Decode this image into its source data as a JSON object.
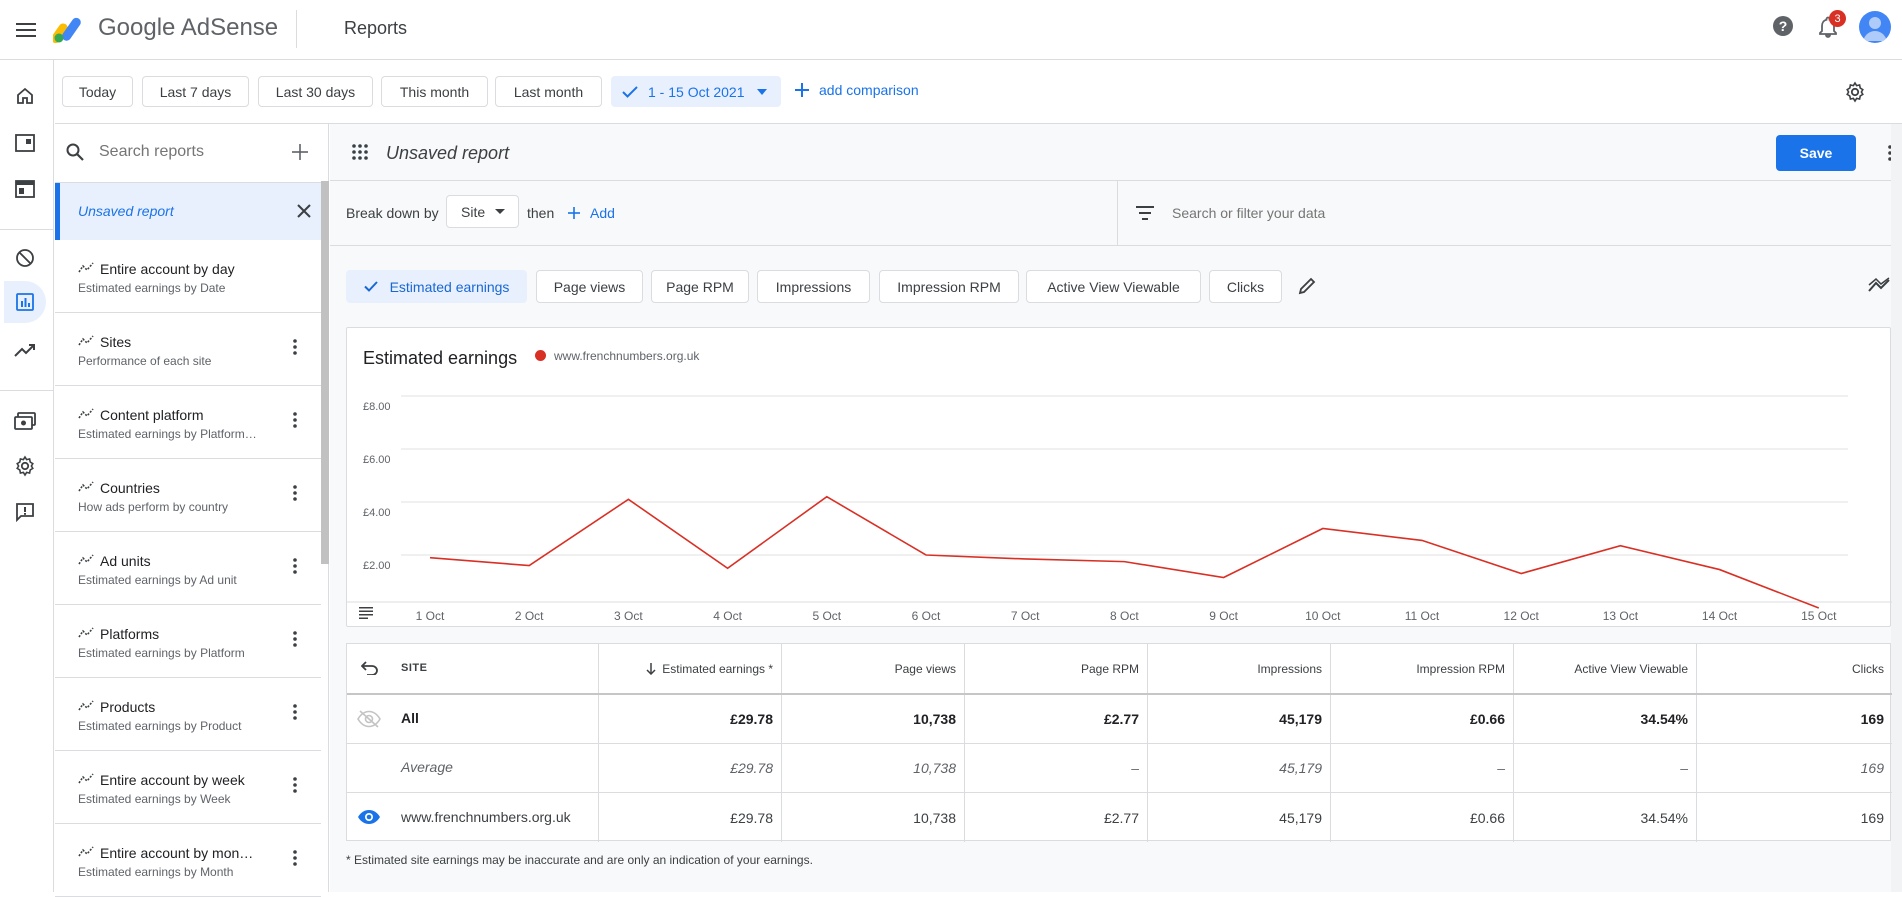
{
  "header": {
    "brand": "Google AdSense",
    "page_title": "Reports",
    "notification_count": "3"
  },
  "datebar": {
    "chips": [
      "Today",
      "Last 7 days",
      "Last 30 days",
      "This month",
      "Last month"
    ],
    "selected_range": "1 - 15 Oct 2021",
    "add_comparison": "add comparison"
  },
  "sidebar": {
    "search_placeholder": "Search reports",
    "active_report": "Unsaved report",
    "reports": [
      {
        "title": "Entire account by day",
        "subtitle": "Estimated earnings by Date"
      },
      {
        "title": "Sites",
        "subtitle": "Performance of each site"
      },
      {
        "title": "Content platform",
        "subtitle": "Estimated earnings by Platform…"
      },
      {
        "title": "Countries",
        "subtitle": "How ads perform by country"
      },
      {
        "title": "Ad units",
        "subtitle": "Estimated earnings by Ad unit"
      },
      {
        "title": "Platforms",
        "subtitle": "Estimated earnings by Platform"
      },
      {
        "title": "Products",
        "subtitle": "Estimated earnings by Product"
      },
      {
        "title": "Entire account by week",
        "subtitle": "Estimated earnings by Week"
      },
      {
        "title": "Entire account by mon…",
        "subtitle": "Estimated earnings by Month"
      }
    ]
  },
  "report": {
    "title": "Unsaved report",
    "save_label": "Save",
    "break_down_label": "Break down by",
    "break_down_value": "Site",
    "then_label": "then",
    "add_label": "Add",
    "filter_placeholder": "Search or filter your data",
    "metric_chips": [
      "Estimated earnings",
      "Page views",
      "Page RPM",
      "Impressions",
      "Impression RPM",
      "Active View Viewable",
      "Clicks"
    ]
  },
  "chart_data": {
    "type": "line",
    "title": "Estimated earnings",
    "categories": [
      "1 Oct",
      "2 Oct",
      "3 Oct",
      "4 Oct",
      "5 Oct",
      "6 Oct",
      "7 Oct",
      "8 Oct",
      "9 Oct",
      "10 Oct",
      "11 Oct",
      "12 Oct",
      "13 Oct",
      "14 Oct",
      "15 Oct"
    ],
    "series": [
      {
        "name": "www.frenchnumbers.org.uk",
        "color": "#d93025",
        "values": [
          1.9,
          1.6,
          4.1,
          1.5,
          4.2,
          2.0,
          1.85,
          1.75,
          1.15,
          3.0,
          2.55,
          1.3,
          2.35,
          1.45,
          0.0
        ]
      }
    ],
    "y_ticks": [
      "£8.00",
      "£6.00",
      "£4.00",
      "£2.00"
    ],
    "y_tick_values": [
      8,
      6,
      4,
      2
    ],
    "ylim": [
      0,
      8
    ],
    "grid": true,
    "legend_position": "top-left"
  },
  "table": {
    "headers": [
      "SITE",
      "Estimated earnings *",
      "Page views",
      "Page RPM",
      "Impressions",
      "Impression RPM",
      "Active View Viewable",
      "Clicks"
    ],
    "rows": [
      {
        "label": "All",
        "values": [
          "£29.78",
          "10,738",
          "£2.77",
          "45,179",
          "£0.66",
          "34.54%",
          "169"
        ]
      },
      {
        "label": "Average",
        "values": [
          "£29.78",
          "10,738",
          "–",
          "45,179",
          "–",
          "–",
          "169"
        ]
      },
      {
        "label": "www.frenchnumbers.org.uk",
        "values": [
          "£29.78",
          "10,738",
          "£2.77",
          "45,179",
          "£0.66",
          "34.54%",
          "169"
        ]
      }
    ],
    "footnote": "* Estimated site earnings may be inaccurate and are only an indication of your earnings."
  },
  "colors": {
    "accent": "#1a73e8",
    "series": "#d93025",
    "badge": "#d93025"
  }
}
